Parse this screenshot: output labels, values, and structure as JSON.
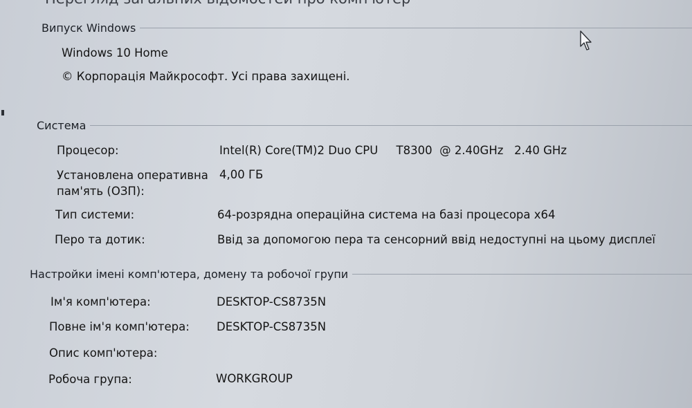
{
  "header": {
    "title_partial": "Перегляд загальних відомостей про комп'ютер"
  },
  "windows_edition": {
    "heading": "Випуск Windows",
    "edition": "Windows 10 Home",
    "copyright": "© Корпорація Майкрософт. Усі права захищені."
  },
  "system": {
    "heading": "Система",
    "rows": [
      {
        "label": "Процесор:",
        "value": "Intel(R) Core(TM)2 Duo CPU     T8300  @ 2.40GHz   2.40 GHz"
      },
      {
        "label": "Установлена оперативна пам'ять (ОЗП):",
        "value": "4,00 ГБ"
      },
      {
        "label": "Тип системи:",
        "value": "64-розрядна операційна система на базі процесора x64"
      },
      {
        "label": "Перо та дотик:",
        "value": "Ввід за допомогою пера та сенсорний ввід недоступні на цьому дисплеї"
      }
    ]
  },
  "computer_name": {
    "heading": "Настройки імені комп'ютера, домену та робочої групи",
    "rows": [
      {
        "label": "Ім'я комп'ютера:",
        "value": "DESKTOP-CS8735N"
      },
      {
        "label": "Повне ім'я комп'ютера:",
        "value": "DESKTOP-CS8735N"
      },
      {
        "label": "Опис комп'ютера:",
        "value": ""
      },
      {
        "label": "Робоча група:",
        "value": "WORKGROUP"
      }
    ]
  },
  "colors": {
    "background": "#d3d7dd",
    "text": "#141414",
    "rule": "#9aa1ab"
  }
}
